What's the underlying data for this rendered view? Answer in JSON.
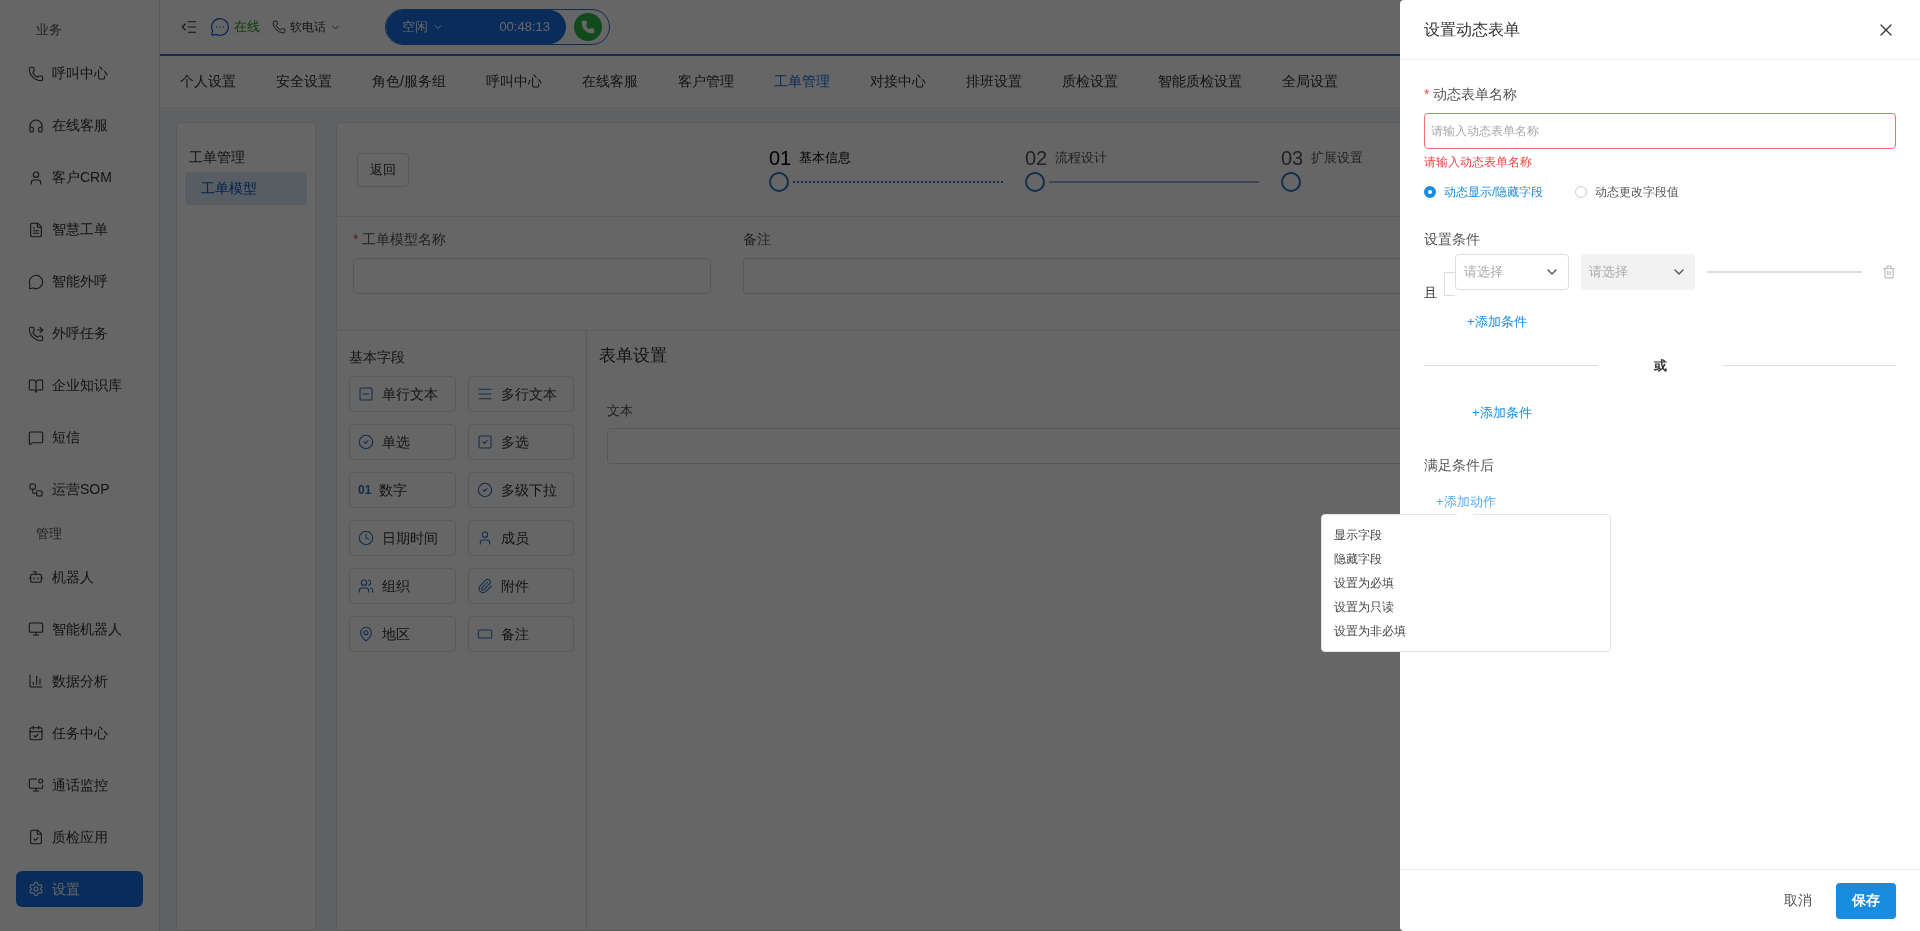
{
  "sidebar": {
    "sections": [
      {
        "title": "业务",
        "items": [
          {
            "label": "呼叫中心",
            "selected": false
          },
          {
            "label": "在线客服",
            "selected": false
          },
          {
            "label": "客户CRM",
            "selected": false
          },
          {
            "label": "智慧工单",
            "selected": false
          },
          {
            "label": "智能外呼",
            "selected": false
          },
          {
            "label": "外呼任务",
            "selected": false
          },
          {
            "label": "企业知识库",
            "selected": false
          },
          {
            "label": "短信",
            "selected": false
          },
          {
            "label": "运营SOP",
            "selected": false
          }
        ]
      },
      {
        "title": "管理",
        "items": [
          {
            "label": "机器人",
            "selected": false
          },
          {
            "label": "智能机器人",
            "selected": false
          },
          {
            "label": "数据分析",
            "selected": false
          },
          {
            "label": "任务中心",
            "selected": false
          },
          {
            "label": "通话监控",
            "selected": false
          },
          {
            "label": "质检应用",
            "selected": false
          },
          {
            "label": "设置",
            "selected": true
          }
        ]
      }
    ]
  },
  "topbar": {
    "presence": "在线",
    "phone_label": "软电话",
    "call": {
      "status": "空闲",
      "timer": "00:48:13"
    }
  },
  "tabs": [
    {
      "label": "个人设置",
      "selected": false
    },
    {
      "label": "安全设置",
      "selected": false
    },
    {
      "label": "角色/服务组",
      "selected": false
    },
    {
      "label": "呼叫中心",
      "selected": false
    },
    {
      "label": "在线客服",
      "selected": false
    },
    {
      "label": "客户管理",
      "selected": false
    },
    {
      "label": "工单管理",
      "selected": true
    },
    {
      "label": "对接中心",
      "selected": false
    },
    {
      "label": "排班设置",
      "selected": false
    },
    {
      "label": "质检设置",
      "selected": false
    },
    {
      "label": "智能质检设置",
      "selected": false
    },
    {
      "label": "全局设置",
      "selected": false
    }
  ],
  "left_panel": {
    "title": "工单管理",
    "items": [
      {
        "label": "工单模型",
        "selected": true
      }
    ]
  },
  "editor": {
    "back": "返回",
    "steps": [
      {
        "number": "01",
        "label": "基本信息",
        "active": true
      },
      {
        "number": "02",
        "label": "流程设计",
        "active": false
      },
      {
        "number": "03",
        "label": "扩展设置",
        "active": false
      }
    ],
    "fields": [
      {
        "label": "工单模型名称",
        "required_mark": "*"
      },
      {
        "label": "备注"
      }
    ],
    "palette": {
      "title": "基本字段",
      "items": [
        {
          "label": "单行文本"
        },
        {
          "label": "多行文本"
        },
        {
          "label": "单选"
        },
        {
          "label": "多选"
        },
        {
          "label": "数字",
          "glyph": "01"
        },
        {
          "label": "多级下拉"
        },
        {
          "label": "日期时间"
        },
        {
          "label": "成员"
        },
        {
          "label": "组织"
        },
        {
          "label": "附件"
        },
        {
          "label": "地区"
        },
        {
          "label": "备注"
        }
      ]
    },
    "form": {
      "title": "表单设置",
      "field_label": "文本"
    }
  },
  "drawer": {
    "title": "设置动态表单",
    "name_field": {
      "label": "动态表单名称",
      "required_mark": "*",
      "placeholder": "请输入动态表单名称",
      "error": "请输入动态表单名称"
    },
    "modes": [
      {
        "label": "动态显示/隐藏字段",
        "selected": true
      },
      {
        "label": "动态更改字段值",
        "selected": false
      }
    ],
    "conditions": {
      "label": "设置条件",
      "groups": [
        {
          "joiner": "且",
          "rows": [
            {
              "field_placeholder": "请选择",
              "operator_placeholder": "请选择",
              "operator_disabled": true
            }
          ],
          "add_label": "+添加条件"
        }
      ],
      "separator": "或",
      "add_label": "+添加条件"
    },
    "actions": {
      "label": "满足条件后",
      "add_label": "+添加动作"
    },
    "menu": [
      "显示字段",
      "隐藏字段",
      "设置为必填",
      "设置为只读",
      "设置为非必填"
    ],
    "footer": {
      "cancel": "取消",
      "save": "保存"
    }
  }
}
